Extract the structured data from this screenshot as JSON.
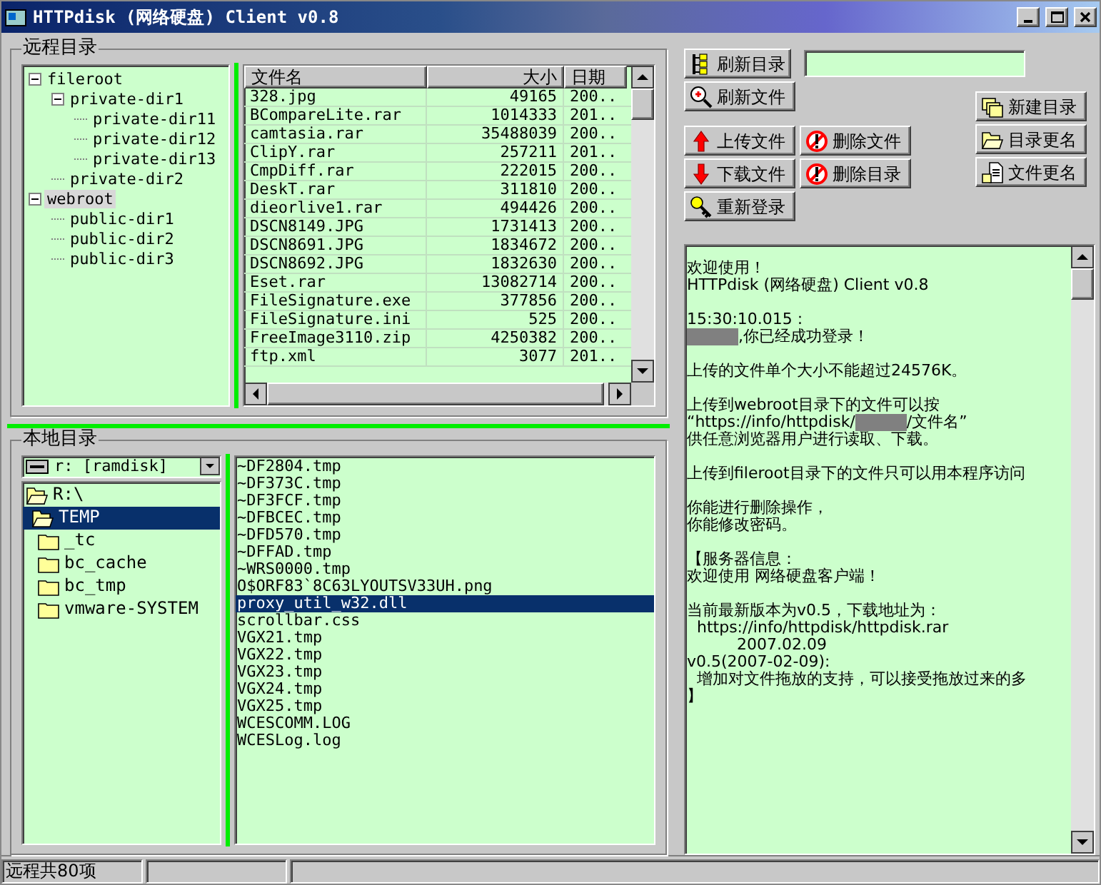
{
  "window": {
    "title": "HTTPdisk (网络硬盘) Client v0.8"
  },
  "remote": {
    "label": "远程目录",
    "tree": [
      {
        "label": "fileroot",
        "expanded": true,
        "selected": false,
        "children": [
          {
            "label": "private-dir1",
            "expanded": true,
            "selected": false,
            "children": [
              {
                "label": "private-dir11",
                "selected": false
              },
              {
                "label": "private-dir12",
                "selected": false
              },
              {
                "label": "private-dir13",
                "selected": false
              }
            ]
          },
          {
            "label": "private-dir2",
            "selected": false
          }
        ]
      },
      {
        "label": "webroot",
        "expanded": true,
        "selected": true,
        "children": [
          {
            "label": "public-dir1",
            "selected": false
          },
          {
            "label": "public-dir2",
            "selected": false
          },
          {
            "label": "public-dir3",
            "selected": false
          }
        ]
      }
    ],
    "columns": [
      "文件名",
      "大小",
      "日期"
    ],
    "rows": [
      [
        "328.jpg",
        "49165",
        "200.."
      ],
      [
        "BCompareLite.rar",
        "1014333",
        "201.."
      ],
      [
        "camtasia.rar",
        "35488039",
        "200.."
      ],
      [
        "ClipY.rar",
        "257211",
        "201.."
      ],
      [
        "CmpDiff.rar",
        "222015",
        "200.."
      ],
      [
        "DeskT.rar",
        "311810",
        "200.."
      ],
      [
        "dieorlive1.rar",
        "494426",
        "200.."
      ],
      [
        "DSCN8149.JPG",
        "1731413",
        "200.."
      ],
      [
        "DSCN8691.JPG",
        "1834672",
        "200.."
      ],
      [
        "DSCN8692.JPG",
        "1832630",
        "200.."
      ],
      [
        "Eset.rar",
        "13082714",
        "200.."
      ],
      [
        "FileSignature.exe",
        "377856",
        "200.."
      ],
      [
        "FileSignature.ini",
        "525",
        "200.."
      ],
      [
        "FreeImage3110.zip",
        "4250382",
        "200.."
      ],
      [
        "ftp.xml",
        "3077",
        "201.."
      ]
    ]
  },
  "local": {
    "label": "本地目录",
    "drive": "r: [ramdisk]",
    "folders": [
      {
        "label": "R:\\",
        "kind": "open",
        "selected": false,
        "children": [
          {
            "label": "TEMP",
            "kind": "open",
            "selected": true,
            "children": [
              {
                "label": "_tc",
                "kind": "closed",
                "selected": false
              },
              {
                "label": "bc_cache",
                "kind": "closed",
                "selected": false
              },
              {
                "label": "bc_tmp",
                "kind": "closed",
                "selected": false
              },
              {
                "label": "vmware-SYSTEM",
                "kind": "closed",
                "selected": false
              }
            ]
          }
        ]
      }
    ],
    "files": [
      {
        "name": "~DF2804.tmp",
        "selected": false
      },
      {
        "name": "~DF373C.tmp",
        "selected": false
      },
      {
        "name": "~DF3FCF.tmp",
        "selected": false
      },
      {
        "name": "~DFBCEC.tmp",
        "selected": false
      },
      {
        "name": "~DFD570.tmp",
        "selected": false
      },
      {
        "name": "~DFFAD.tmp",
        "selected": false
      },
      {
        "name": "~WRS0000.tmp",
        "selected": false
      },
      {
        "name": "O$ORF83`8C63LYOUTSV33UH.png",
        "selected": false
      },
      {
        "name": "proxy_util_w32.dll",
        "selected": true
      },
      {
        "name": "scrollbar.css",
        "selected": false
      },
      {
        "name": "VGX21.tmp",
        "selected": false
      },
      {
        "name": "VGX22.tmp",
        "selected": false
      },
      {
        "name": "VGX23.tmp",
        "selected": false
      },
      {
        "name": "VGX24.tmp",
        "selected": false
      },
      {
        "name": "VGX25.tmp",
        "selected": false
      },
      {
        "name": "WCESCOMM.LOG",
        "selected": false
      },
      {
        "name": "WCESLog.log",
        "selected": false
      }
    ]
  },
  "buttons": {
    "left": [
      {
        "label": "刷新目录",
        "kind": "tree"
      },
      {
        "label": "刷新文件",
        "kind": "magnifier"
      }
    ],
    "transfer": [
      {
        "label": "上传文件",
        "kind": "up"
      },
      {
        "label": "删除文件",
        "kind": "forbid"
      },
      {
        "label": "下载文件",
        "kind": "down"
      },
      {
        "label": "删除目录",
        "kind": "forbid"
      },
      {
        "label": "重新登录",
        "kind": "key"
      }
    ],
    "right": [
      {
        "label": "新建目录",
        "kind": "folders"
      },
      {
        "label": "目录更名",
        "kind": "openfolder"
      },
      {
        "label": "文件更名",
        "kind": "document"
      }
    ]
  },
  "log": [
    [
      [
        {
          "kind": "text",
          "text": "欢迎使用！"
        }
      ],
      [
        {
          "kind": "text",
          "text": "HTTPdisk (网络硬盘) Client v0.8"
        }
      ]
    ],
    [
      [
        {
          "kind": "text",
          "text": "15:30:10.015 :"
        }
      ],
      [
        {
          "kind": "redacted"
        },
        {
          "kind": "text",
          "text": ",你已经成功登录！"
        }
      ]
    ],
    [
      [
        {
          "kind": "text",
          "text": "上传的文件单个大小不能超过24576K。"
        }
      ]
    ],
    [
      [
        {
          "kind": "text",
          "text": "上传到webroot目录下的文件可以按"
        }
      ],
      [
        {
          "kind": "text",
          "text": "“https://info/httpdisk/"
        },
        {
          "kind": "redacted"
        },
        {
          "kind": "text",
          "text": "/文件名”"
        }
      ],
      [
        {
          "kind": "text",
          "text": "供任意浏览器用户进行读取、下载。"
        }
      ]
    ],
    [
      [
        {
          "kind": "text",
          "text": "上传到fileroot目录下的文件只可以用本程序访问"
        }
      ]
    ],
    [
      [
        {
          "kind": "text",
          "text": "你能进行删除操作，"
        }
      ],
      [
        {
          "kind": "text",
          "text": "你能修改密码。"
        }
      ]
    ],
    [
      [
        {
          "kind": "text",
          "text": "【服务器信息："
        }
      ],
      [
        {
          "kind": "text",
          "text": "欢迎使用 网络硬盘客户端！"
        }
      ]
    ],
    [
      [
        {
          "kind": "text",
          "text": "当前最新版本为v0.5，下载地址为："
        }
      ],
      [
        {
          "kind": "text",
          "text": "  https://info/httpdisk/httpdisk.rar"
        }
      ],
      [
        {
          "kind": "text",
          "text": "          2007.02.09"
        }
      ],
      [
        {
          "kind": "text",
          "text": "v0.5(2007-02-09):"
        }
      ],
      [
        {
          "kind": "text",
          "text": "  增加对文件拖放的支持，可以接受拖放过来的多"
        }
      ],
      [
        {
          "kind": "text",
          "text": "】"
        }
      ]
    ]
  ],
  "status_bar": [
    "远程共80项"
  ]
}
